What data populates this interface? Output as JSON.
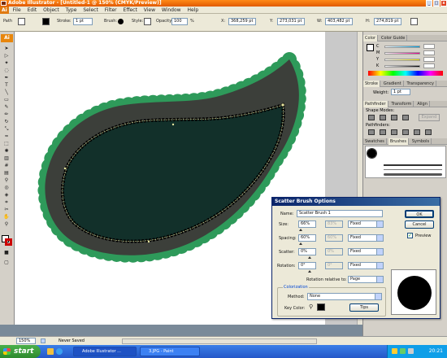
{
  "app": {
    "title": "Adobe Illustrator - [Untitled-1 @ 150% (CMYK/Preview)]",
    "menu": [
      "File",
      "Edit",
      "Object",
      "Type",
      "Select",
      "Filter",
      "Effect",
      "View",
      "Window",
      "Help"
    ]
  },
  "control_bar": {
    "path_label": "Path",
    "stroke_label": "Stroke:",
    "stroke_value": "1 pt",
    "brush_label": "Brush:",
    "style_label": "Style:",
    "opacity_label": "Opacity:",
    "opacity_value": "100",
    "opacity_unit": "%",
    "x_label": "X:",
    "x_value": "368,259 pt",
    "y_label": "Y:",
    "y_value": "273,031 pt",
    "w_label": "W:",
    "w_value": "403,482 pt",
    "h_label": "H:",
    "h_value": "274,819 pt"
  },
  "panels": {
    "color_tabs": [
      "Color",
      "Color Guide"
    ],
    "cmyk_labels": [
      "C",
      "M",
      "Y",
      "K"
    ],
    "stroke_tabs": [
      "Stroke",
      "Gradient",
      "Transparency"
    ],
    "weight_label": "Weight:",
    "weight_value": "1 pt",
    "pathfinder_tabs": [
      "Pathfinder",
      "Transform",
      "Align"
    ],
    "shape_modes_label": "Shape Modes:",
    "expand_label": "Expand",
    "pathfinders_label": "Pathfinders:",
    "brush_tabs": [
      "Swatches",
      "Brushes",
      "Symbols"
    ]
  },
  "status": {
    "zoom": "150%",
    "info": "Never Saved"
  },
  "taskbar": {
    "start": "start",
    "items": [
      "Adobe Illustrator ...",
      "3.JPG - Paint"
    ],
    "time": "20:21"
  },
  "dialog": {
    "title": "Scatter Brush Options",
    "name_label": "Name:",
    "name_value": "Scatter Brush 1",
    "ok_label": "OK",
    "cancel_label": "Cancel",
    "preview_label": "Preview",
    "preview_checked": true,
    "size_label": "Size:",
    "size_value": "66%",
    "size_value2": "83%",
    "size_mode": "Fixed",
    "spacing_label": "Spacing:",
    "spacing_value": "60%",
    "spacing_value2": "60%",
    "spacing_mode": "Fixed",
    "scatter_label": "Scatter:",
    "scatter_value": "0%",
    "scatter_value2": "0%",
    "scatter_mode": "Fixed",
    "rotation_label": "Rotation:",
    "rotation_value": "0°",
    "rotation_value2": "0°",
    "rotation_mode": "Fixed",
    "rotation_relative_label": "Rotation relative to:",
    "rotation_relative_value": "Page",
    "colorization_label": "Colorization",
    "method_label": "Method:",
    "method_value": "None",
    "key_color_label": "Key Color:",
    "tips_label": "Tips"
  },
  "colors": {
    "paisley_fill": "#12302a",
    "paisley_band": "#3c3f3a",
    "scallop_green": "#2e9a5a",
    "dialog_title": "#0a246a",
    "titlebar": "#ff7a10"
  }
}
